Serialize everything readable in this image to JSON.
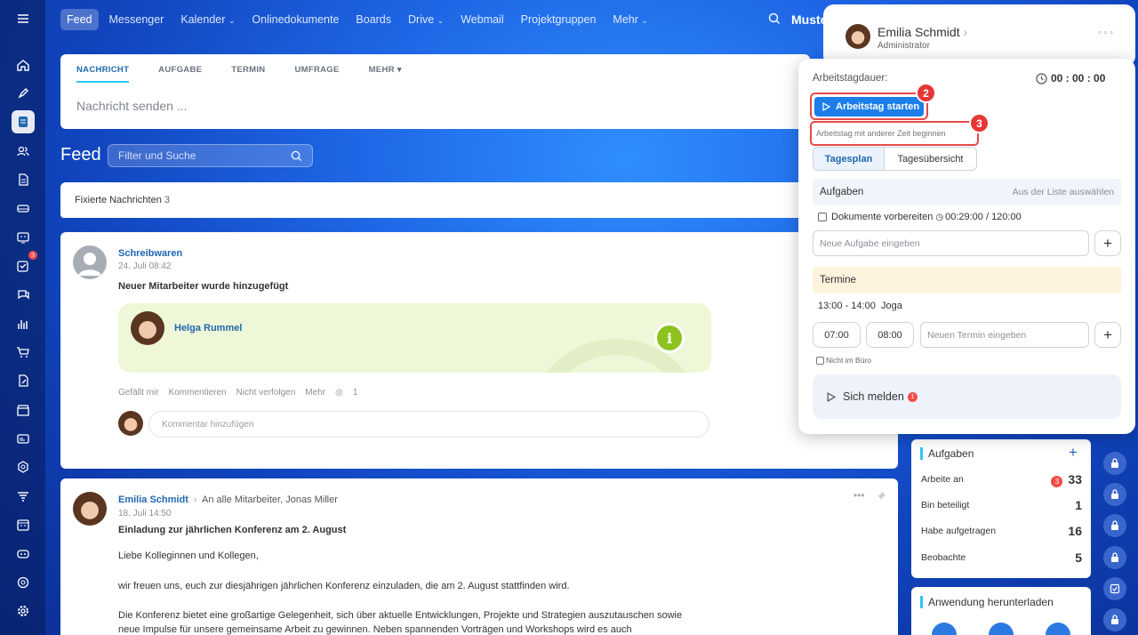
{
  "topnav": {
    "items": [
      "Feed",
      "Messenger",
      "Kalender",
      "Onlinedokumente",
      "Boards",
      "Drive",
      "Webmail",
      "Projektgruppen",
      "Mehr"
    ],
    "search_partial": "Muste"
  },
  "leftnav": {
    "tasks_count": "3"
  },
  "composer": {
    "tabs": [
      "NACHRICHT",
      "AUFGABE",
      "TERMIN",
      "UMFRAGE",
      "MEHR"
    ],
    "placeholder": "Nachricht senden ..."
  },
  "feed": {
    "title": "Feed",
    "filter_placeholder": "Filter und Suche",
    "pinned_label": "Fixierte Nachrichten",
    "pinned_count": "3"
  },
  "post1": {
    "author": "Schreibwaren",
    "date": "24. Juli 08:42",
    "text": "Neuer Mitarbeiter wurde hinzugefügt",
    "employee": "Helga Rummel",
    "actions": [
      "Gefällt mir",
      "Kommentieren",
      "Nicht verfolgen",
      "Mehr"
    ],
    "views": "1",
    "comment_placeholder": "Kommentar hinzufügen"
  },
  "post2": {
    "author": "Emilia Schmidt",
    "recipients": "An alle Mitarbeiter, Jonas Miller",
    "date": "18. Juli 14:50",
    "title": "Einladung zur jährlichen Konferenz am 2. August",
    "p1": "Liebe Kolleginnen und Kollegen,",
    "p2": "wir freuen uns, euch zur diesjährigen jährlichen Konferenz einzuladen, die am 2. August stattfinden wird.",
    "p3a": "Die Konferenz bietet eine großartige Gelegenheit, sich über aktuelle Entwicklungen, Projekte und Strategien auszutauschen sowie",
    "p3b": "neue Impulse für unsere gemeinsame Arbeit zu gewinnen. Neben spannenden Vorträgen und Workshops wird es auch"
  },
  "profile": {
    "name": "Emilia Schmidt",
    "role": "Administrator"
  },
  "panel": {
    "duration_label": "Arbeitstagdauer:",
    "timer": "00 : 00 : 00",
    "start_button": "Arbeitstag starten",
    "other_time": "Arbeitstag mit anderer Zeit beginnen",
    "badge2": "2",
    "badge3": "3",
    "tabs": [
      "Tagesplan",
      "Tagesübersicht"
    ],
    "tasks_header": "Aufgaben",
    "from_list": "Aus der Liste auswählen",
    "task_item": "Dokumente vorbereiten",
    "task_time": "00:29:00 / 120:00",
    "new_task_placeholder": "Neue Aufgabe eingeben",
    "events_header": "Termine",
    "event_time": "13:00 - 14:00",
    "event_name": "Joga",
    "time_from": "07:00",
    "time_to": "08:00",
    "new_event_placeholder": "Neuen Termin eingeben",
    "not_in_office": "Nicht im Büro",
    "report_button": "Sich melden",
    "report_count": "1"
  },
  "tasks_widget": {
    "title": "Aufgaben",
    "rows": [
      {
        "label": "Arbeite an",
        "count": "33",
        "badge": "3"
      },
      {
        "label": "Bin beteiligt",
        "count": "1"
      },
      {
        "label": "Habe aufgetragen",
        "count": "16"
      },
      {
        "label": "Beobachte",
        "count": "5"
      }
    ]
  },
  "download_widget": {
    "title": "Anwendung herunterladen"
  }
}
